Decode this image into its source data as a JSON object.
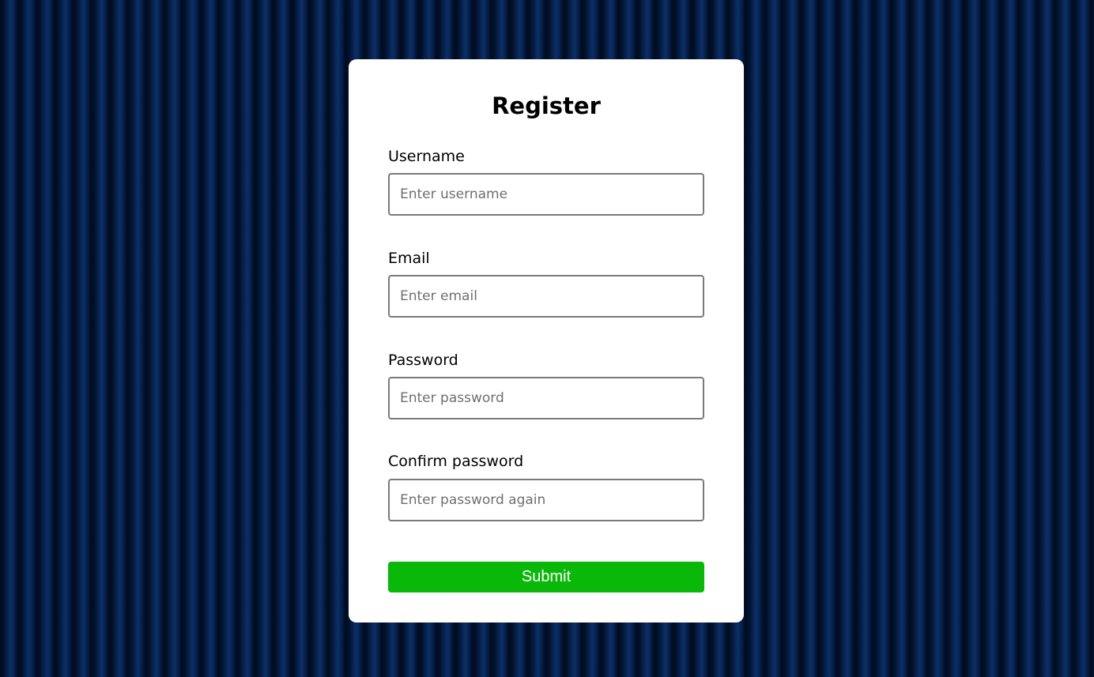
{
  "form": {
    "title": "Register",
    "fields": [
      {
        "label": "Username",
        "placeholder": "Enter username",
        "value": ""
      },
      {
        "label": "Email",
        "placeholder": "Enter email",
        "value": ""
      },
      {
        "label": "Password",
        "placeholder": "Enter password",
        "value": ""
      },
      {
        "label": "Confirm password",
        "placeholder": "Enter password again",
        "value": ""
      }
    ],
    "submit_label": "Submit"
  },
  "colors": {
    "background": "#021536",
    "card": "#ffffff",
    "submit": "#0ab80a",
    "input_border": "#7a7a7a"
  }
}
